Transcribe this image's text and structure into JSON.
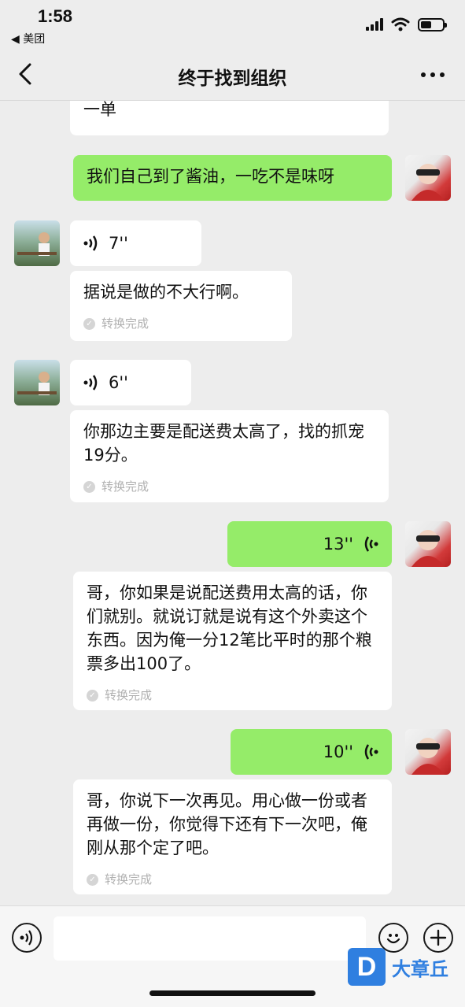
{
  "status": {
    "time": "1:58",
    "back_app": "◀ 美团"
  },
  "nav": {
    "title": "终于找到组织"
  },
  "messages": {
    "m0": {
      "text": "一单"
    },
    "m1": {
      "text": "我们自己到了酱油，一吃不是味呀"
    },
    "m2": {
      "duration": "7''"
    },
    "m3": {
      "text": "据说是做的不大行啊。",
      "status": "转换完成"
    },
    "m4": {
      "duration": "6''"
    },
    "m5": {
      "text": "你那边主要是配送费太高了，找的抓宠19分。",
      "status": "转换完成"
    },
    "m6": {
      "duration": "13''"
    },
    "m7": {
      "text": "哥，你如果是说配送费用太高的话，你们就别。就说订就是说有这个外卖这个东西。因为俺一分12笔比平时的那个粮票多出100了。",
      "status": "转换完成"
    },
    "m8": {
      "duration": "10''"
    },
    "m9": {
      "text": "哥，你说下一次再见。用心做一份或者再做一份，你觉得下还有下一次吧，俺刚从那个定了吧。",
      "status": "转换完成"
    }
  },
  "input": {
    "placeholder": ""
  },
  "watermark": {
    "letter": "D",
    "text": "大章丘"
  },
  "icons": [
    "back-icon",
    "more-icon",
    "voice-wave-icon",
    "check-icon",
    "voice-input-icon",
    "emoji-icon",
    "plus-icon"
  ]
}
